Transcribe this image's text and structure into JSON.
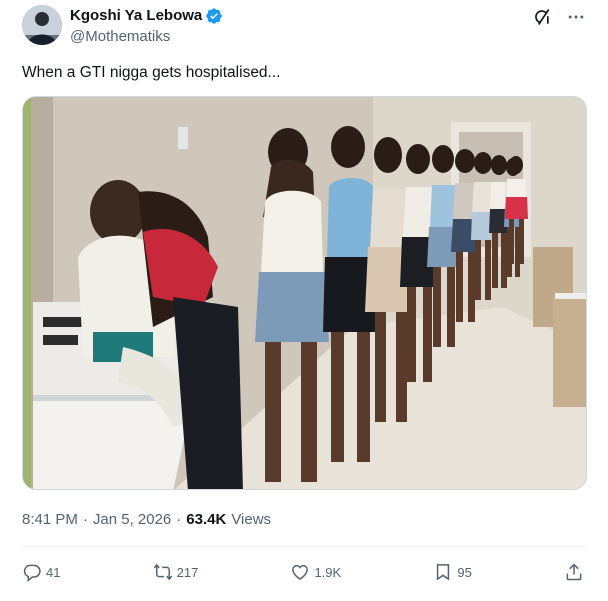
{
  "author": {
    "display_name": "Kgoshi Ya Lebowa",
    "handle": "@Mothematiks",
    "verified_icon": "verified-badge-icon"
  },
  "top_icons": [
    "grok-icon",
    "more-icon"
  ],
  "tweet": {
    "text": "When a GTI nigga gets hospitalised..."
  },
  "meta": {
    "time": "8:41 PM",
    "separator1": "·",
    "date": "Jan 5, 2026",
    "separator2": "·",
    "views_count": "63.4K",
    "views_label": "Views"
  },
  "actions": {
    "replies": "41",
    "reposts": "217",
    "likes": "1.9K",
    "bookmarks": "95"
  },
  "colors": {
    "text_primary": "#0f1419",
    "text_secondary": "#536471",
    "verified": "#1d9bf0",
    "divider": "#eff3f4"
  }
}
